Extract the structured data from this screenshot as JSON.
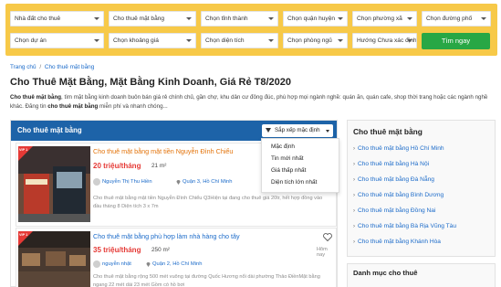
{
  "search": {
    "fields": [
      "Nhà đất cho thuê",
      "Cho thuê mặt bằng",
      "Chọn tỉnh thành",
      "Chọn quận huyện",
      "Chọn phường xã",
      "Chọn đường phố",
      "Chọn dự án",
      "Chọn khoảng giá",
      "Chọn diện tích",
      "Chọn phòng ngủ",
      "Hướng Chưa xác định"
    ],
    "submit_label": "Tìm ngay"
  },
  "breadcrumb": {
    "home": "Trang chủ",
    "separator": "/",
    "current": "Cho thuê mặt bằng"
  },
  "page": {
    "title": "Cho Thuê Mặt Bằng, Mặt Bằng Kinh Doanh, Giá Rẻ T8/2020",
    "intro_bold1": "Cho thuê mặt bằng",
    "intro_text1": ", tìm mặt bằng kinh doanh buôn bán giá rẻ chính chủ, gần chợ, khu dân cư đông đúc, phù hợp mọi ngành nghề: quán ăn, quán cafe, shop thời trang hoặc các ngành nghề khác. Đăng tin ",
    "intro_bold2": "cho thuê mặt bằng",
    "intro_text2": " miễn phí và nhanh chóng..."
  },
  "listing": {
    "header_title": "Cho thuê mặt bằng",
    "sort_label": "Sắp xếp mặc định",
    "sort_options": [
      "Mặc định",
      "Tin mới nhất",
      "Giá thấp nhất",
      "Diện tích lớn nhất"
    ],
    "items": [
      {
        "vip": "VIP 1",
        "title": "Cho thuê mặt bằng mặt tiền Nguyễn Đình Chiểu",
        "price": "20 triệu/tháng",
        "area": "21 m²",
        "author": "Nguyễn Thị Thu Hiền",
        "location": "Quận 3, Hồ Chí Minh",
        "desc": "Cho thuê mặt bằng mặt tiền Nguyễn Đình Chiểu Q3Hiện tại đang cho thuê giá 20tr, hết hợp đồng vào đầu tháng 8 Diện tích 3 x 7m"
      },
      {
        "vip": "VIP 1",
        "title": "Cho thuê mặt bằng phù hợp làm nhà hàng cho tây",
        "price": "35 triệu/tháng",
        "area": "250 m²",
        "author": "nguyễn nhật",
        "location": "Quận 2, Hồ Chí Minh",
        "time": "Hôm nay",
        "desc": "Cho thuê mặt bằng rộng 500 mét vuông tại đường Quốc Hương nổi dài phường Thảo ĐiềnMặt bằng ngang 22 mét dài 23 mét Gồm có hồ bơi"
      }
    ]
  },
  "sidebar": {
    "title": "Cho thuê mặt bằng",
    "links": [
      "Cho thuê mặt bằng Hồ Chí Minh",
      "Cho thuê mặt bằng Hà Nội",
      "Cho thuê mặt bằng Đà Nẵng",
      "Cho thuê mặt bằng Bình Dương",
      "Cho thuê mặt bằng Đồng Nai",
      "Cho thuê mặt bằng Bà Rịa Vũng Tàu",
      "Cho thuê mặt bằng Khánh Hòa"
    ],
    "second_title": "Danh mục cho thuê"
  },
  "colors": {
    "search_bg": "#f7c948",
    "header_blue": "#1d63a8",
    "link_blue": "#1a6ac9",
    "price_red": "#e53935",
    "button_green": "#28a745",
    "title_orange": "#e3730a"
  }
}
